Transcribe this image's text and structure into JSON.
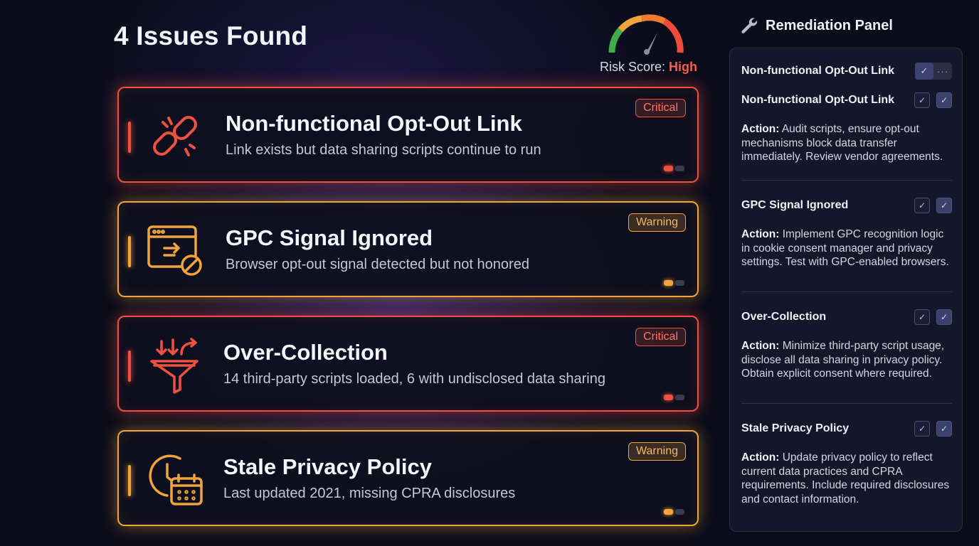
{
  "header": {
    "title": "4 Issues Found"
  },
  "risk": {
    "label": "Risk Score:",
    "level": "High",
    "level_color": "#ff5a4a"
  },
  "colors": {
    "critical": "#ef5140",
    "warning": "#f0a43a",
    "background": "#0b0c1a"
  },
  "issues": [
    {
      "title": "Non-functional Opt-Out Link",
      "description": "Link exists but data sharing scripts continue to run",
      "severity": "Critical",
      "icon": "broken-link-icon"
    },
    {
      "title": "GPC Signal Ignored",
      "description": "Browser opt-out signal detected but not honored",
      "severity": "Warning",
      "icon": "browser-blocked-signal-icon"
    },
    {
      "title": "Over-Collection",
      "description": "14 third-party scripts loaded, 6 with undisclosed data sharing",
      "severity": "Critical",
      "icon": "funnel-icon"
    },
    {
      "title": "Stale Privacy Policy",
      "description": "Last updated 2021, missing CPRA disclosures",
      "severity": "Warning",
      "icon": "clock-calendar-icon"
    }
  ],
  "panel": {
    "title": "Remediation Panel",
    "icon": "wrench-icon",
    "top_item": {
      "label": "Non-functional Opt-Out Link",
      "check_glyph": "✓",
      "more_glyph": "···"
    },
    "action_prefix": "Action:",
    "check_glyph": "✓",
    "sections": [
      {
        "title": "Non-functional Opt-Out Link",
        "action": "Audit scripts, ensure opt-out mechanisms block data transfer immediately. Review vendor agreements."
      },
      {
        "title": "GPC Signal Ignored",
        "action": "Implement GPC recognition logic in cookie consent manager and privacy settings. Test with GPC-enabled browsers."
      },
      {
        "title": "Over-Collection",
        "action": "Minimize third-party script usage, disclose all data sharing in privacy policy. Obtain explicit consent where required."
      },
      {
        "title": "Stale Privacy Policy",
        "action": "Update privacy policy to reflect current data practices and CPRA requirements. Include required disclosures and contact information."
      }
    ]
  }
}
